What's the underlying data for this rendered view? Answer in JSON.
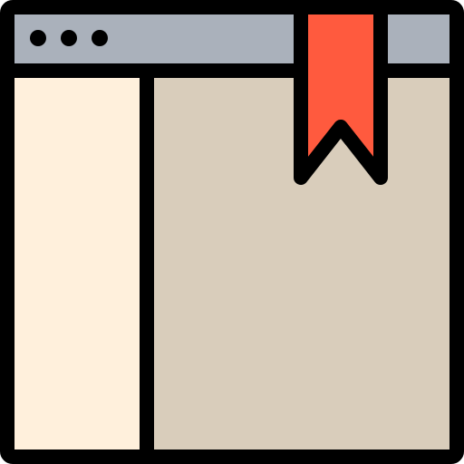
{
  "icon": {
    "name": "browser-window-bookmark-icon",
    "parts": {
      "window": "browser-window",
      "title_bar": "window-title-bar",
      "dots": [
        "window-dot",
        "window-dot",
        "window-dot"
      ],
      "sidebar": "sidebar-panel",
      "content": "content-panel",
      "bookmark": "bookmark-ribbon"
    }
  },
  "colors": {
    "outline": "#000000",
    "title_bar": "#aab1bb",
    "sidebar": "#fff0dc",
    "content": "#d9cdbb",
    "bookmark": "#ff5a3e"
  }
}
